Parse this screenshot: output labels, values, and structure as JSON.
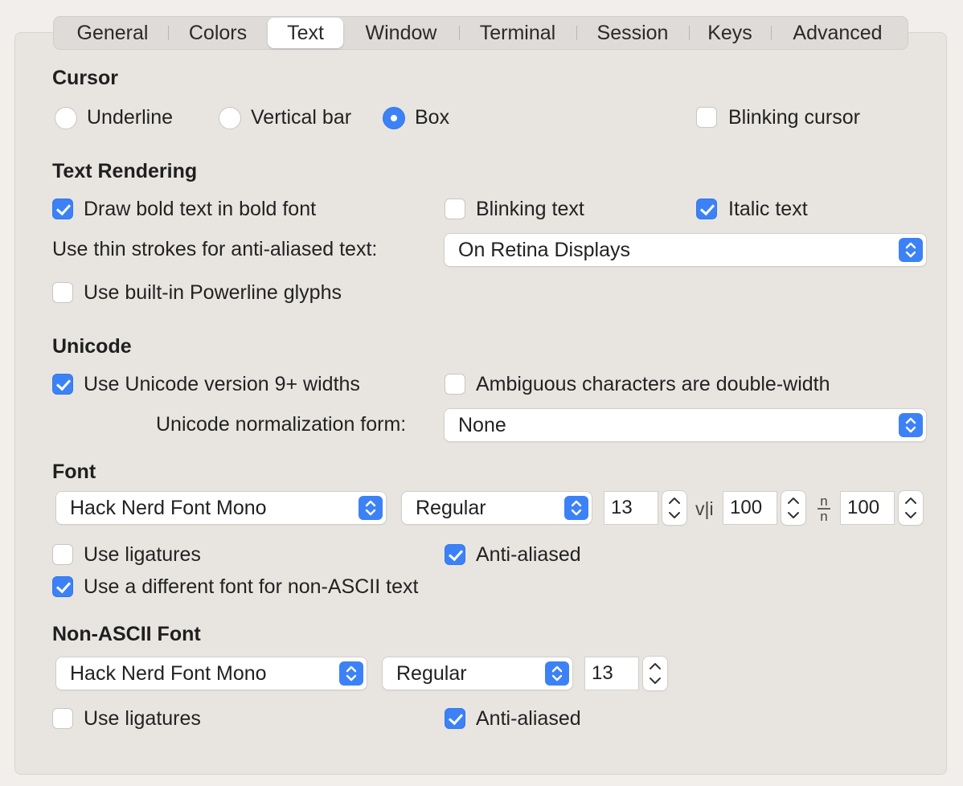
{
  "tabs": [
    {
      "label": "General"
    },
    {
      "label": "Colors"
    },
    {
      "label": "Text",
      "active": true
    },
    {
      "label": "Window"
    },
    {
      "label": "Terminal"
    },
    {
      "label": "Session"
    },
    {
      "label": "Keys"
    },
    {
      "label": "Advanced"
    }
  ],
  "cursor": {
    "heading": "Cursor",
    "options": {
      "underline": "Underline",
      "vertical_bar": "Vertical bar",
      "box": "Box"
    },
    "selected": "Box",
    "blinking_label": "Blinking cursor",
    "blinking_checked": false
  },
  "text_rendering": {
    "heading": "Text Rendering",
    "draw_bold_label": "Draw bold text in bold font",
    "draw_bold_checked": true,
    "blinking_text_label": "Blinking text",
    "blinking_text_checked": false,
    "italic_label": "Italic text",
    "italic_checked": true,
    "thin_strokes_label": "Use thin strokes for anti-aliased text:",
    "thin_strokes_value": "On Retina Displays",
    "powerline_label": "Use built-in Powerline glyphs",
    "powerline_checked": false
  },
  "unicode": {
    "heading": "Unicode",
    "v9_label": "Use Unicode version 9+ widths",
    "v9_checked": true,
    "ambiguous_label": "Ambiguous characters are double-width",
    "ambiguous_checked": false,
    "normalization_label": "Unicode normalization form:",
    "normalization_value": "None"
  },
  "font": {
    "heading": "Font",
    "family": "Hack Nerd Font Mono",
    "style": "Regular",
    "size": "13",
    "h_spacing_glyph": "v|i",
    "h_spacing": "100",
    "v_spacing_glyph": "n/n",
    "v_spacing": "100",
    "ligatures_label": "Use ligatures",
    "ligatures_checked": false,
    "antialiased_label": "Anti-aliased",
    "antialiased_checked": true,
    "non_ascii_label": "Use a different font for non-ASCII text",
    "non_ascii_checked": true
  },
  "non_ascii_font": {
    "heading": "Non-ASCII Font",
    "family": "Hack Nerd Font Mono",
    "style": "Regular",
    "size": "13",
    "ligatures_label": "Use ligatures",
    "ligatures_checked": false,
    "antialiased_label": "Anti-aliased",
    "antialiased_checked": true
  },
  "colors": {
    "accent": "#3c82f6",
    "panel": "#e8e5e1",
    "window": "#f1eeeb"
  },
  "icons": {
    "popup_chevron": "chevron-up-down-icon",
    "stepper": "stepper-arrows-icon",
    "checkmark": "checkmark-icon"
  }
}
